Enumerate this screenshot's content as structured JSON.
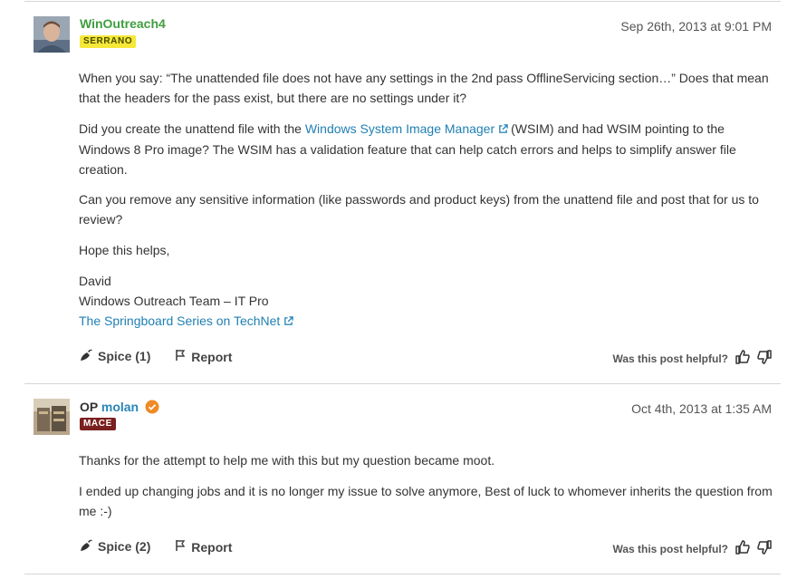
{
  "posts": [
    {
      "author": "WinOutreach4",
      "op_label": "",
      "badge": "SERRANO",
      "date": "Sep 26th, 2013 at 9:01 PM",
      "p1": "When you say: “The unattended file does not have any settings in the 2nd pass OfflineServicing section…” Does that mean that the headers for the pass exist, but there are no settings under it?",
      "p2_before": "Did you create the unattend file with the ",
      "p2_link": "Windows System Image Manager",
      "p2_after": "(WSIM) and had WSIM pointing to the Windows 8 Pro image? The WSIM has a validation feature that can help catch errors and helps to simplify answer file creation.",
      "p3": "Can you remove any sensitive information (like passwords and product keys) from the unattend file and post that for us to review?",
      "p4": "Hope this helps,",
      "sig_name": "David",
      "sig_team": "Windows Outreach Team – IT Pro",
      "sig_link": "The Springboard Series on TechNet",
      "spice": "Spice (1)",
      "report": "Report",
      "helpful": "Was this post helpful?"
    },
    {
      "author": "molan",
      "op_label": "OP",
      "badge": "MACE",
      "date": "Oct 4th, 2013 at 1:35 AM",
      "p1": "Thanks for the attempt to help me with this but my question became moot.",
      "p2": "I ended up changing jobs and it is no longer my issue to solve anymore, Best of luck to whomever inherits the question from me :-)",
      "spice": "Spice (2)",
      "report": "Report",
      "helpful": "Was this post helpful?"
    }
  ],
  "colors": {
    "author_green": "#3e9e3e",
    "op_blue": "#2a86b7",
    "link_blue": "#1f7fb3",
    "serrano_badge": "#f5e838",
    "mace_badge": "#7a1f1f",
    "verified_orange": "#f08a24"
  }
}
